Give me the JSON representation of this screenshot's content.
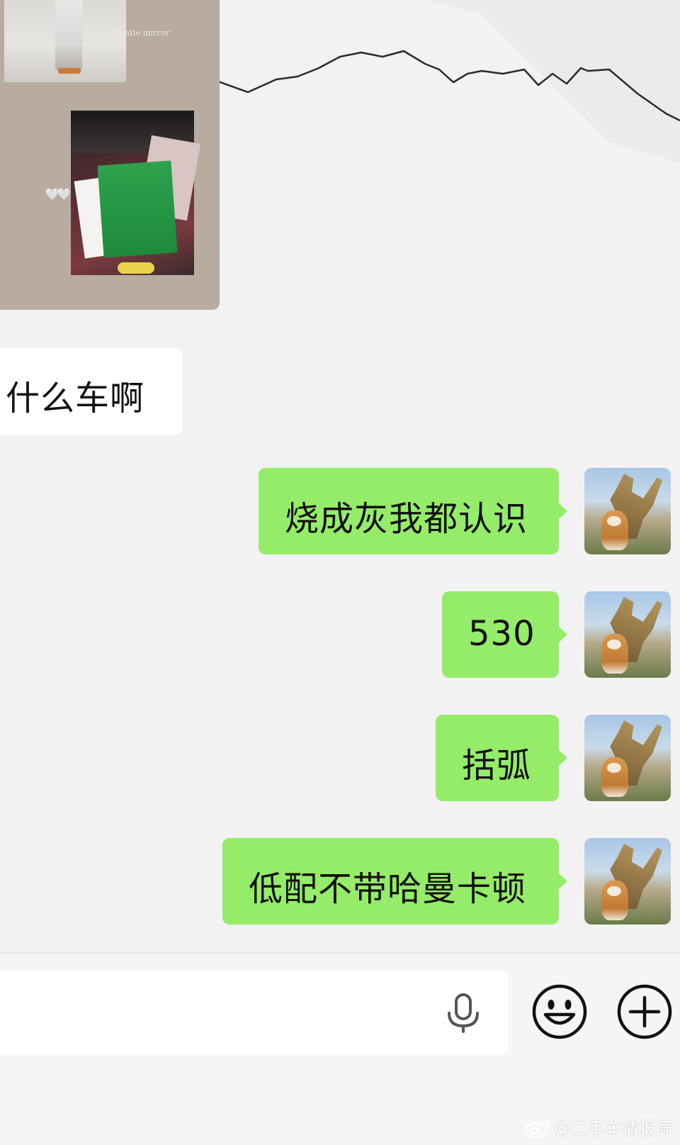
{
  "shared_post": {
    "caption": "Gentle mirror",
    "hearts": "🤍🤍"
  },
  "messages": {
    "incoming": [
      {
        "text": "什么车啊"
      }
    ],
    "outgoing": [
      {
        "text": "烧成灰我都认识"
      },
      {
        "text": "530"
      },
      {
        "text": "括弧"
      },
      {
        "text": "低配不带哈曼卡顿"
      }
    ]
  },
  "input": {
    "placeholder": "",
    "value": ""
  },
  "toolbar": {
    "voice_icon": "microphone-icon",
    "emoji_icon": "smiley-icon",
    "more_icon": "plus-icon"
  },
  "watermark": {
    "text": "@二手车情报局"
  },
  "colors": {
    "chat_background": "#f2f2f2",
    "outgoing_bubble": "#95ec69",
    "incoming_bubble": "#ffffff",
    "post_background": "#b8aca1"
  }
}
